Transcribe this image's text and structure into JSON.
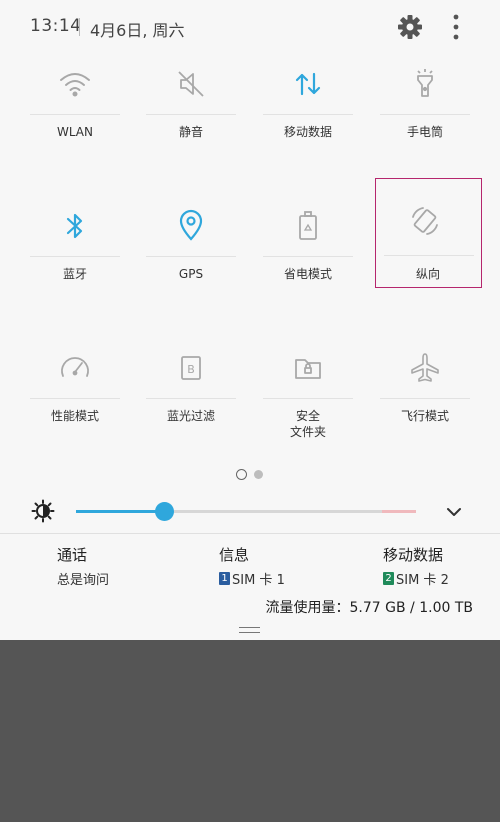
{
  "status": {
    "time": "13:14",
    "date": "4月6日, 周六"
  },
  "tiles": [
    {
      "label": "WLAN",
      "icon": "wifi-icon",
      "active": false
    },
    {
      "label": "静音",
      "icon": "mute-icon",
      "active": false
    },
    {
      "label": "移动数据",
      "icon": "mobile-data-icon",
      "active": true
    },
    {
      "label": "手电筒",
      "icon": "flashlight-icon",
      "active": false
    },
    {
      "label": "蓝牙",
      "icon": "bluetooth-icon",
      "active": true
    },
    {
      "label": "GPS",
      "icon": "location-icon",
      "active": true
    },
    {
      "label": "省电模式",
      "icon": "battery-saver-icon",
      "active": false
    },
    {
      "label": "纵向",
      "icon": "rotate-icon",
      "active": false,
      "selected": true
    },
    {
      "label": "性能模式",
      "icon": "speedometer-icon",
      "active": false
    },
    {
      "label": "蓝光过滤",
      "icon": "blue-light-filter-icon",
      "active": false
    },
    {
      "label": "安全\n文件夹",
      "icon": "secure-folder-icon",
      "active": false
    },
    {
      "label": "飞行模式",
      "icon": "airplane-icon",
      "active": false
    }
  ],
  "pager": {
    "current": 1,
    "total": 2
  },
  "brightness": {
    "level": 0.26
  },
  "sim": {
    "call": {
      "title": "通话",
      "value": "总是询问"
    },
    "message": {
      "title": "信息",
      "badge": "1",
      "value": "SIM 卡 1"
    },
    "data": {
      "title": "移动数据",
      "badge": "2",
      "value": "SIM 卡 2"
    }
  },
  "usage": "流量使用量：5.77 GB / 1.00 TB",
  "colors": {
    "accent": "#2fa7dc",
    "inactive": "#a8a8a8",
    "selection": "#b5266d",
    "sim1": "#2a5d9f",
    "sim2": "#1f8a5a"
  }
}
